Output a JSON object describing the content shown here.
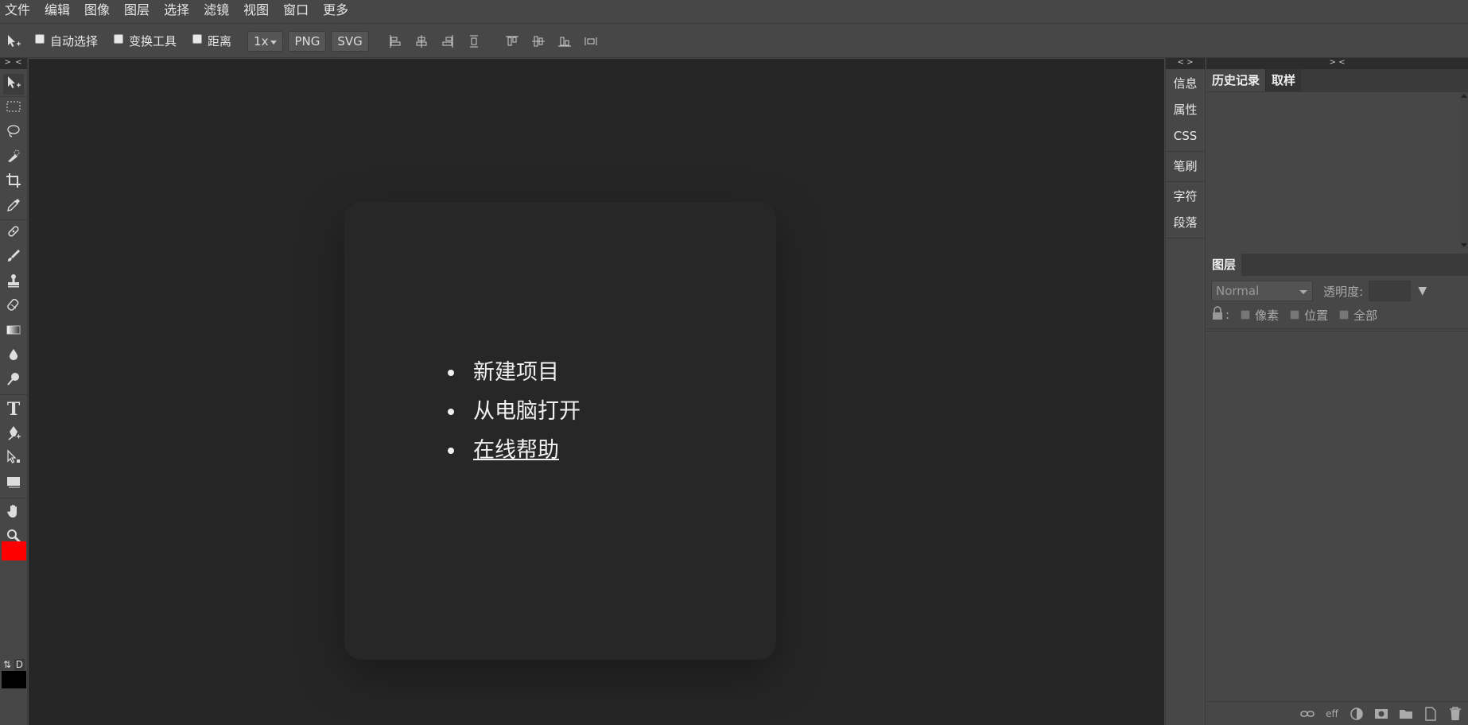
{
  "menubar": {
    "items": [
      "文件",
      "编辑",
      "图像",
      "图层",
      "选择",
      "滤镜",
      "视图",
      "窗口",
      "更多"
    ]
  },
  "options": {
    "auto_select": "自动选择",
    "transform_tools": "变换工具",
    "distance": "距离",
    "scale": "1x",
    "png": "PNG",
    "svg": "SVG"
  },
  "collapse": {
    "left": "> <",
    "side": "< >",
    "right": "> <"
  },
  "welcome": {
    "items": [
      "新建项目",
      "从电脑打开",
      "在线帮助"
    ]
  },
  "sidepanel": {
    "items": [
      "信息",
      "属性",
      "CSS",
      "笔刷",
      "字符",
      "段落"
    ]
  },
  "history": {
    "tab_history": "历史记录",
    "tab_sample": "取样"
  },
  "layers": {
    "tab": "图层",
    "blend_mode": "Normal",
    "opacity_label": "透明度:",
    "lock_label": ":",
    "lock_pixels": "像素",
    "lock_position": "位置",
    "lock_all": "全部",
    "footer_eff": "eff"
  },
  "swatches": {
    "foreground": "#ff0000",
    "background": "#000000",
    "default_label": "D",
    "swap_label": "⇅"
  }
}
